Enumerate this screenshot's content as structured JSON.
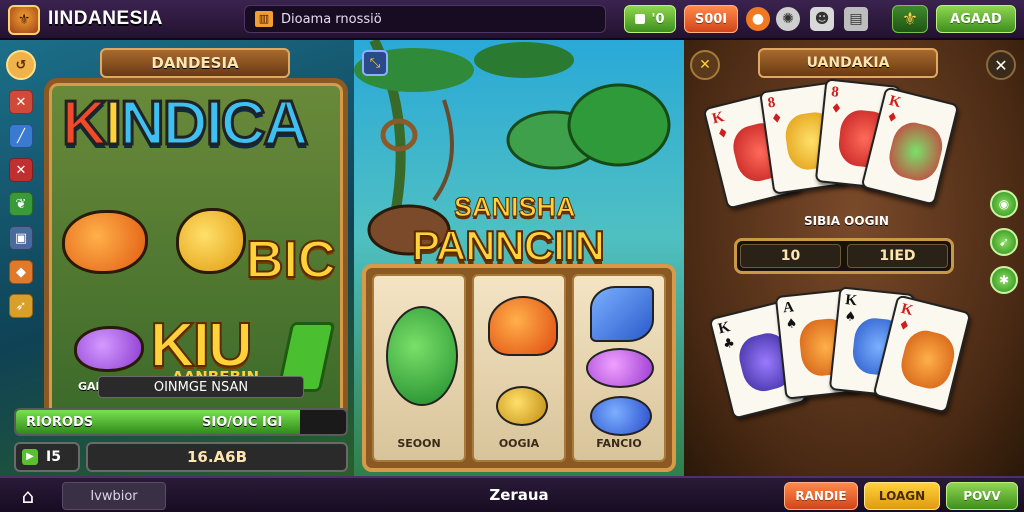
{
  "header": {
    "logo_icon": "crest-logo-icon",
    "brand": "IINDANESIA",
    "search_text": "Dioama rnossiö",
    "coins_label": "'0",
    "score_label": "S00I",
    "location_icon": "location-pin-icon",
    "film_icon": "film-reel-icon",
    "robot_icon": "robot-icon",
    "chest_icon": "chest-icon",
    "fleur_icon": "fleur-de-lis-icon",
    "action_label": "AGAAD"
  },
  "left_game": {
    "banner": "DANDESIA",
    "title": "KINDICA",
    "title_parts": [
      "K",
      "I",
      "NDICA"
    ],
    "word_1": "BIC",
    "word_2": "KIU",
    "label_small": "GANICIE",
    "label_yellow": "AANBEBIN",
    "caption": "OINMGE NSAN",
    "progress": {
      "label": "RIORODS",
      "value": "SIO/OIC IGI",
      "fraction": 0.86
    },
    "level": "I5",
    "amount": "16.A6B",
    "side_icons": [
      "sword-icon",
      "wand-icon",
      "shield-icon",
      "leaf-icon",
      "bag-icon",
      "gem-icon",
      "arrow-icon"
    ],
    "back_icon": "back-arrow-icon"
  },
  "mid_game": {
    "title_1": "SANISHA",
    "title_2": "PANNCIIN",
    "corner_icon": "expand-icon",
    "reels": [
      {
        "label": "SEOON"
      },
      {
        "label": "OOGIA"
      },
      {
        "label": "FANCIO"
      }
    ]
  },
  "right_game": {
    "banner": "UANDAKIA",
    "label": "SIBIA OOGIN",
    "values": [
      "10",
      "1IED"
    ],
    "top_cards": [
      {
        "rank": "K",
        "suit": "♦",
        "color": "red"
      },
      {
        "rank": "8",
        "suit": "♦",
        "color": "red"
      },
      {
        "rank": "8",
        "suit": "♦",
        "color": "red"
      },
      {
        "rank": "K",
        "suit": "♦",
        "color": "red"
      }
    ],
    "bottom_cards": [
      {
        "rank": "K",
        "suit": "♣",
        "color": "black"
      },
      {
        "rank": "A",
        "suit": "♠",
        "color": "black"
      },
      {
        "rank": "K",
        "suit": "♠",
        "color": "black"
      },
      {
        "rank": "K",
        "suit": "♦",
        "color": "red"
      }
    ],
    "tool_icon": "crossed-tools-icon",
    "close_icon": "close-icon",
    "side_icons": [
      "coin-icon",
      "runner-icon",
      "gear-icon"
    ]
  },
  "footer": {
    "home_icon": "home-icon",
    "tab_label": "Ivwbior",
    "title": "Zeraua",
    "btn_1": "RANDIE",
    "btn_2": "LOAGN",
    "btn_3": "POVV"
  }
}
